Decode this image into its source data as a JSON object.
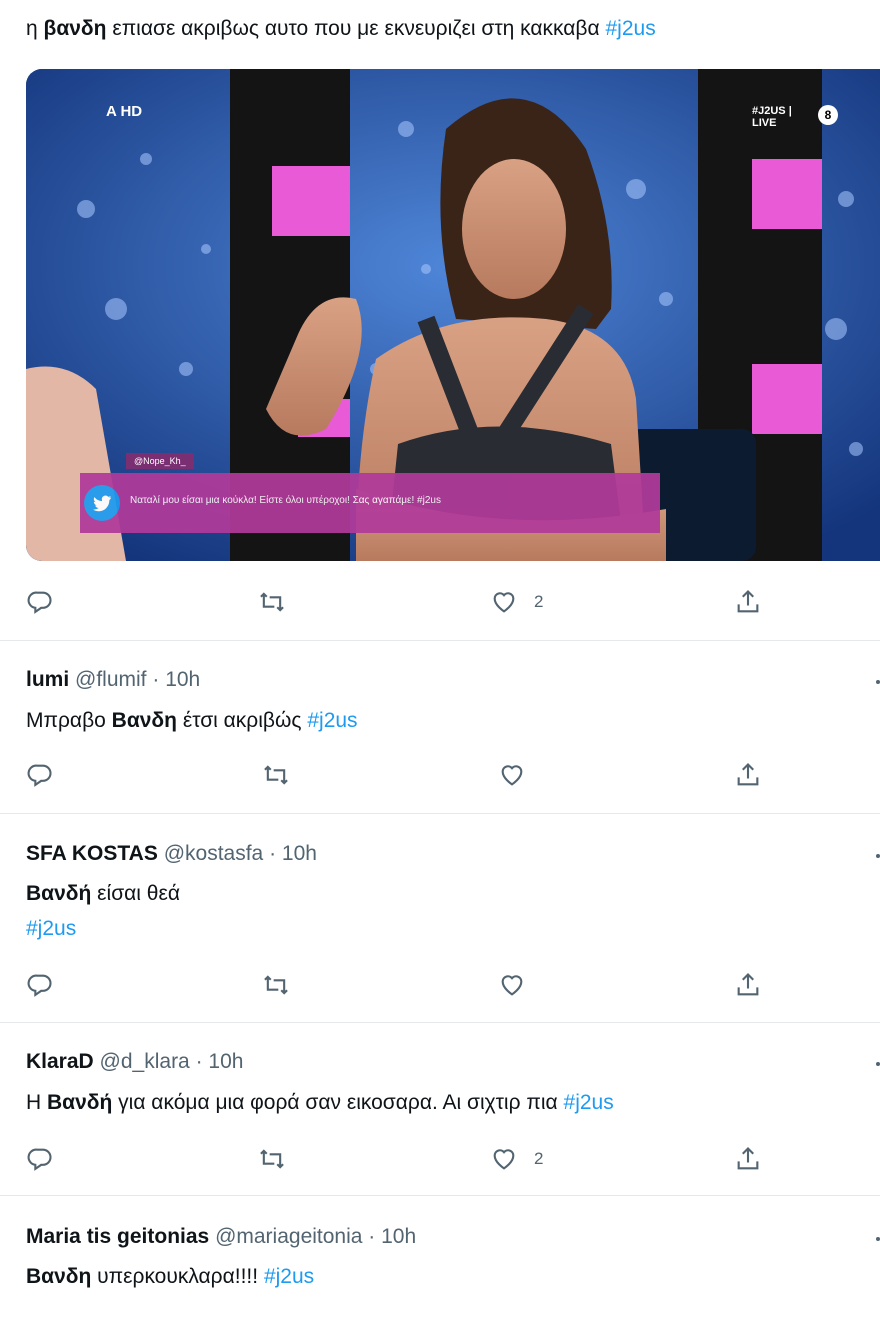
{
  "tweets": [
    {
      "text_parts": [
        {
          "t": "η ",
          "style": "normal"
        },
        {
          "t": "βανδη",
          "style": "bold"
        },
        {
          "t": " επιασε ακριβως αυτο που με εκνευριζει στη κακκαβα ",
          "style": "normal"
        },
        {
          "t": "#j2us",
          "style": "hashtag"
        }
      ],
      "media": {
        "channel_logo": "A HD",
        "show_tag": "#J2US | LIVE",
        "rating": "8",
        "ticker_user": "@Nope_Kh_",
        "ticker_text": "Ναταλί μου είσαι μια κούκλα! Είστε όλοι υπέροχοι! Σας αγαπάμε! #j2us"
      },
      "likes": "2"
    },
    {
      "name": "lumi",
      "handle": "@flumif",
      "time": "10h",
      "text_parts": [
        {
          "t": "Μπραβο ",
          "style": "normal"
        },
        {
          "t": "Βανδη",
          "style": "bold"
        },
        {
          "t": " έτσι ακριβώς ",
          "style": "normal"
        },
        {
          "t": "#j2us",
          "style": "hashtag"
        }
      ],
      "likes": ""
    },
    {
      "name": "SFA KOSTAS",
      "handle": "@kostasfa",
      "time": "10h",
      "line1_parts": [
        {
          "t": "Βανδή",
          "style": "bold"
        },
        {
          "t": " είσαι θεά",
          "style": "normal"
        }
      ],
      "line2": "#j2us",
      "likes": ""
    },
    {
      "name": "KlaraD",
      "handle": "@d_klara",
      "time": "10h",
      "text_parts": [
        {
          "t": "Η ",
          "style": "normal"
        },
        {
          "t": "Βανδή",
          "style": "bold"
        },
        {
          "t": " για ακόμα μια φορά σαν εικοσαρα. Αι σιχτιρ πια  ",
          "style": "normal"
        },
        {
          "t": "#j2us",
          "style": "hashtag"
        }
      ],
      "likes": "2"
    },
    {
      "name": "Maria tis geitonias",
      "handle": "@mariageitonia",
      "time": "10h",
      "text_parts": [
        {
          "t": "Βανδη",
          "style": "bold"
        },
        {
          "t": " υπερκουκλαρα!!!! ",
          "style": "normal"
        },
        {
          "t": "#j2us",
          "style": "hashtag"
        }
      ]
    }
  ],
  "meta_sep": " · ",
  "icons": [
    "reply-icon",
    "retweet-icon",
    "like-icon",
    "share-icon",
    "more-icon",
    "twitter-bird-icon"
  ],
  "colors": {
    "hashtag": "#1d9bf0",
    "text": "#0f1419",
    "secondary": "#536471",
    "ticker": "#b03a9a"
  }
}
